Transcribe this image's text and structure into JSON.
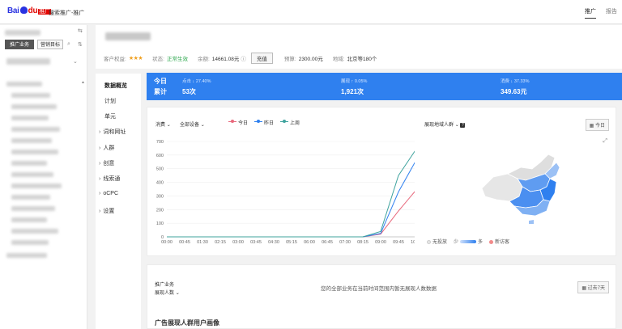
{
  "app": {
    "brand": "Bai",
    "brand_red": "du",
    "brand_sub": "推广",
    "title": "搜索推广-推广",
    "nav": [
      {
        "label": "推广",
        "active": true
      },
      {
        "label": "报告",
        "active": false
      }
    ]
  },
  "sidebar": {
    "tab_active": "推广业务",
    "tab_other": "营销目标"
  },
  "header": {
    "rights_label": "客户权益:",
    "status_label": "状态:",
    "status_value": "正常生效",
    "balance_label": "余额:",
    "balance_value": "14661.08元",
    "charge_label": "充值",
    "budget_label": "预算:",
    "budget_value": "2300.00元",
    "region_label": "地域:",
    "region_value": "北京等180个"
  },
  "subnav": {
    "items": [
      {
        "label": "数据概览",
        "active": true,
        "expandable": false
      },
      {
        "label": "计划",
        "active": false,
        "expandable": false
      },
      {
        "label": "单元",
        "active": false,
        "expandable": false
      },
      {
        "label": "词和网址",
        "active": false,
        "expandable": true
      },
      {
        "label": "人群",
        "active": false,
        "expandable": true
      },
      {
        "label": "创意",
        "active": false,
        "expandable": true
      },
      {
        "label": "线索通",
        "active": false,
        "expandable": true
      },
      {
        "label": "oCPC",
        "active": false,
        "expandable": true
      },
      {
        "label": "设置",
        "active": false,
        "expandable": true
      }
    ]
  },
  "summary": {
    "today_label": "今日",
    "total_label": "累计",
    "metrics": [
      {
        "name": "点击",
        "change": "↓ 27.40%",
        "value": "53次"
      },
      {
        "name": "展现",
        "change": "↑ 0.05%",
        "value": "1,921次"
      },
      {
        "name": "消费",
        "change": "↓ 37.33%",
        "value": "349.63元"
      }
    ]
  },
  "trend": {
    "metric_select": "消费",
    "device_select": "全部设备",
    "region_select": "展现地域人群",
    "today_button": "今日",
    "colors": {
      "today": "#e8697d",
      "yesterday": "#2f80ef",
      "last_week": "#3fa39e"
    }
  },
  "chart_data": {
    "type": "line",
    "x": [
      "00:00",
      "00:45",
      "01:30",
      "02:15",
      "03:00",
      "03:45",
      "04:30",
      "05:15",
      "06:00",
      "06:45",
      "07:30",
      "08:15",
      "09:00",
      "09:45",
      "10:30"
    ],
    "ylim": [
      0,
      700
    ],
    "yticks": [
      0,
      100,
      200,
      300,
      400,
      500,
      600,
      700
    ],
    "series": [
      {
        "name": "今日",
        "values": [
          0,
          0,
          0,
          0,
          0,
          0,
          0,
          0,
          0,
          0,
          0,
          0,
          20,
          190,
          345
        ]
      },
      {
        "name": "昨日",
        "values": [
          0,
          0,
          0,
          0,
          0,
          0,
          0,
          0,
          0,
          0,
          0,
          0,
          25,
          330,
          565
        ]
      },
      {
        "name": "上周",
        "values": [
          0,
          0,
          0,
          0,
          0,
          0,
          0,
          0,
          0,
          0,
          0,
          0,
          40,
          450,
          645
        ]
      }
    ]
  },
  "map": {
    "legend_none": "无投放",
    "legend_few": "少",
    "legend_many": "多",
    "legend_new": "新访客"
  },
  "audience": {
    "label1": "推广业务",
    "label2": "展现人数",
    "message": "您的全部业务在当前时间范围内暂无展现人数数据",
    "range_button": "过去7天",
    "section_title": "广告展现人群用户画像"
  }
}
